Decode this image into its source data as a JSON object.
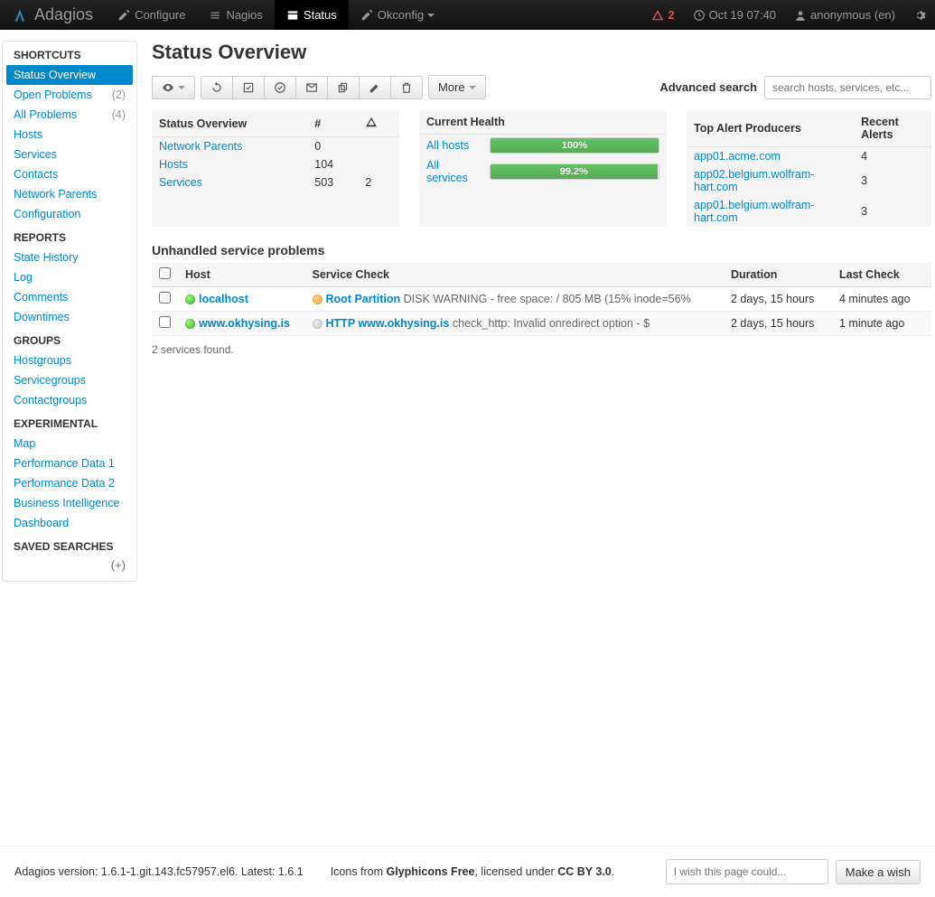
{
  "navbar": {
    "brand": "Adagios",
    "items": [
      {
        "label": "Configure"
      },
      {
        "label": "Nagios"
      },
      {
        "label": "Status"
      },
      {
        "label": "Okconfig"
      }
    ],
    "alert_count": "2",
    "datetime": "Oct 19 07:40",
    "user": "anonymous (en)"
  },
  "sidebar": {
    "sections": [
      {
        "header": "SHORTCUTS",
        "items": [
          {
            "label": "Status Overview",
            "badge": "",
            "active": true
          },
          {
            "label": "Open Problems",
            "badge": "(2)"
          },
          {
            "label": "All Problems",
            "badge": "(4)"
          },
          {
            "label": "Hosts"
          },
          {
            "label": "Services"
          },
          {
            "label": "Contacts"
          },
          {
            "label": "Network Parents"
          },
          {
            "label": "Configuration"
          }
        ]
      },
      {
        "header": "REPORTS",
        "items": [
          {
            "label": "State History"
          },
          {
            "label": "Log"
          },
          {
            "label": "Comments"
          },
          {
            "label": "Downtimes"
          }
        ]
      },
      {
        "header": "GROUPS",
        "items": [
          {
            "label": "Hostgroups"
          },
          {
            "label": "Servicegroups"
          },
          {
            "label": "Contactgroups"
          }
        ]
      },
      {
        "header": "EXPERIMENTAL",
        "items": [
          {
            "label": "Map"
          },
          {
            "label": "Performance Data 1"
          },
          {
            "label": "Performance Data 2"
          },
          {
            "label": "Business Intelligence"
          },
          {
            "label": "Dashboard"
          }
        ]
      },
      {
        "header": "SAVED SEARCHES",
        "items": []
      }
    ],
    "add_search": "(+)"
  },
  "page": {
    "title": "Status Overview",
    "more_label": "More",
    "adv_search": "Advanced search",
    "search_placeholder": "search hosts, services, etc..."
  },
  "status_overview": {
    "title": "Status Overview",
    "col_count": "#",
    "rows": [
      {
        "label": "Network Parents",
        "count": "0",
        "warn": ""
      },
      {
        "label": "Hosts",
        "count": "104",
        "warn": ""
      },
      {
        "label": "Services",
        "count": "503",
        "warn": "2"
      }
    ]
  },
  "current_health": {
    "title": "Current Health",
    "rows": [
      {
        "label": "All hosts",
        "pct": "100%",
        "width": "100%"
      },
      {
        "label": "All services",
        "pct": "99.2%",
        "width": "99.2%"
      }
    ]
  },
  "top_alerts": {
    "title": "Top Alert Producers",
    "col2": "Recent Alerts",
    "rows": [
      {
        "host": "app01.acme.com",
        "n": "4"
      },
      {
        "host": "app02.belgium.wolfram-hart.com",
        "n": "3"
      },
      {
        "host": "app01.belgium.wolfram-hart.com",
        "n": "3"
      }
    ]
  },
  "problems": {
    "title": "Unhandled service problems",
    "cols": {
      "host": "Host",
      "svc": "Service Check",
      "dur": "Duration",
      "last": "Last Check"
    },
    "rows": [
      {
        "host_dot": "ok",
        "host": "localhost",
        "svc_dot": "warn",
        "svc": "Root Partition",
        "svc_desc": " DISK WARNING - free space: / 805 MB (15% inode=56%",
        "dur": "2 days, 15 hours",
        "last": "4 minutes ago"
      },
      {
        "host_dot": "ok",
        "host": "www.okhysing.is",
        "svc_dot": "unk",
        "svc": "HTTP www.okhysing.is",
        "svc_desc": " check_http: Invalid onredirect option - $",
        "dur": "2 days, 15 hours",
        "last": "1 minute ago"
      }
    ],
    "result": "2 services found."
  },
  "footer": {
    "version_pre": "Adagios version: ",
    "version": "1.6.1-1.git.143.fc57957.el6",
    "latest_pre": ". Latest: ",
    "latest": "1.6.1",
    "icons_pre": "Icons from ",
    "icons_name": "Glyphicons Free",
    "license_pre": ", licensed under ",
    "license": "CC BY 3.0",
    "wish_placeholder": "I wish this page could...",
    "wish_btn": "Make a wish"
  }
}
